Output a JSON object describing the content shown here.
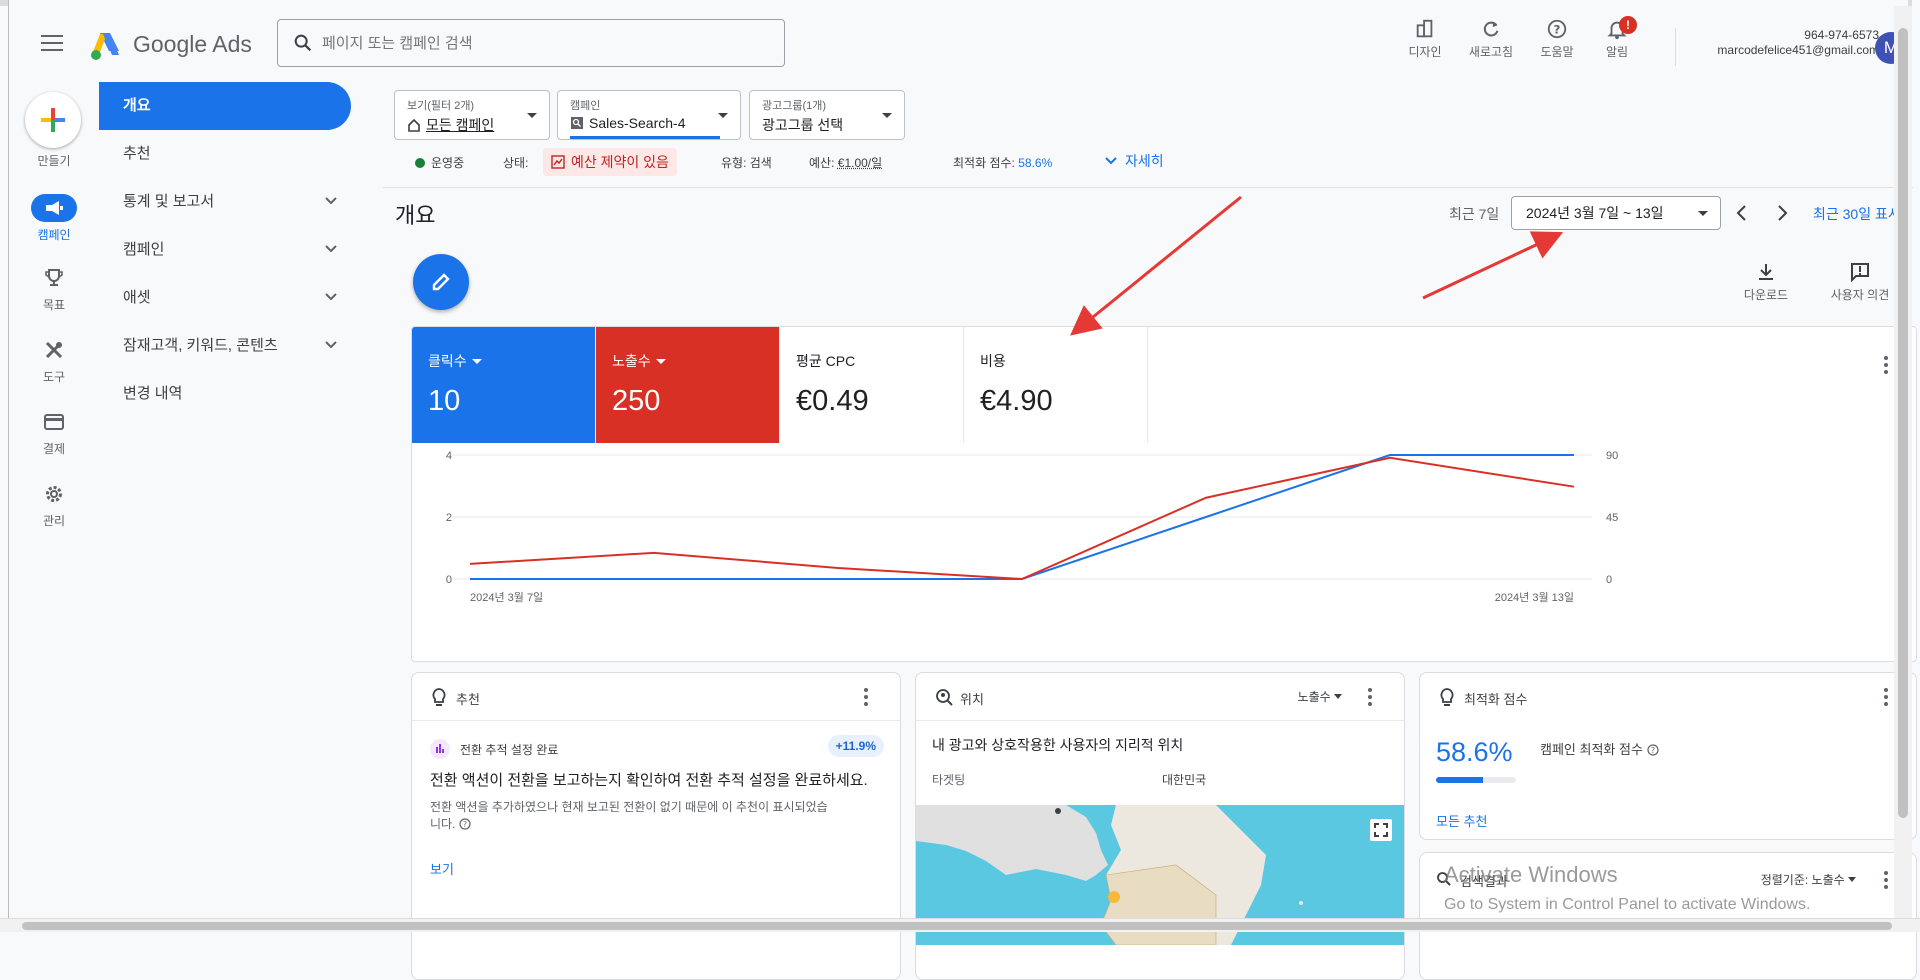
{
  "header": {
    "app_name": "Google Ads",
    "search_placeholder": "페이지 또는 캠페인 검색",
    "tools": [
      "디자인",
      "새로고침",
      "도움말",
      "알림"
    ],
    "alert_count": "!",
    "account_phone": "964-974-6573",
    "account_email": "marcodefelice451@gmail.com",
    "avatar_letter": "M"
  },
  "rail": {
    "create": "만들기",
    "campaigns": "캠페인",
    "goals": "목표",
    "tools": "도구",
    "billing": "결제",
    "admin": "관리"
  },
  "nav": {
    "items": [
      "개요",
      "추천",
      "통계 및 보고서",
      "캠페인",
      "애셋",
      "잠재고객, 키워드, 콘텐츠",
      "변경 내역"
    ]
  },
  "filters": {
    "view_label": "보기(필터 2개)",
    "view_value": "모든 캠페인",
    "campaign_label": "캠페인",
    "campaign_value": "Sales-Search-4",
    "adgroup_label": "광고그룹(1개)",
    "adgroup_value": "광고그룹 선택"
  },
  "status": {
    "running": "운영중",
    "state_label": "상태:",
    "state_value": "예산 제약이 있음",
    "type_label": "유형:",
    "type_value": "검색",
    "budget_label": "예산:",
    "budget_value": "€1.00/일",
    "score_label": "최적화 점수:",
    "score_value": "58.6%",
    "details": "자세히"
  },
  "page": {
    "title": "개요",
    "range_label": "최근 7일",
    "range_value": "2024년 3월 7일 ~ 13일",
    "range_link": "최근 30일 표시",
    "download": "다운로드",
    "feedback": "사용자 의견"
  },
  "metrics": [
    {
      "label": "클릭수",
      "value": "10"
    },
    {
      "label": "노출수",
      "value": "250"
    },
    {
      "label": "평균 CPC",
      "value": "€0.49"
    },
    {
      "label": "비용",
      "value": "€4.90"
    }
  ],
  "colors": {
    "clicks": "#1a73e8",
    "impressions": "#d93025"
  },
  "chart_data": {
    "type": "line",
    "x": [
      "2024년 3월 7일",
      "",
      "",
      "",
      "",
      "",
      "2024년 3월 13일"
    ],
    "x_tick_labels": [
      "2024년 3월 7일",
      "2024년 3월 13일"
    ],
    "y_left_ticks": [
      0,
      2,
      4
    ],
    "y_right_ticks": [
      0,
      45,
      90
    ],
    "ylim_left": [
      0,
      4
    ],
    "ylim_right": [
      0,
      90
    ],
    "series": [
      {
        "name": "클릭수",
        "axis": "left",
        "values": [
          0,
          0,
          0,
          0,
          2,
          4,
          4
        ]
      },
      {
        "name": "노출수",
        "axis": "right",
        "values": [
          11,
          19,
          8,
          0,
          59,
          88,
          67
        ]
      }
    ],
    "grid": true
  },
  "cards": {
    "rec_title": "추천",
    "rec_chip": "전환 추적 설정 완료",
    "rec_pct": "+11.9%",
    "rec_heading": "전환 액션이 전환을 보고하는지 확인하여 전환 추적 설정을 완료하세요.",
    "rec_desc": "전환 액션을 추가하였으나 현재 보고된 전환이 없기 때문에 이 추천이 표시되었습니다.",
    "rec_link": "보기",
    "loc_title": "위치",
    "loc_metric": "노출수",
    "loc_heading": "내 광고와 상호작용한 사용자의 지리적 위치",
    "loc_targeting": "타겟팅",
    "loc_country": "대한민국",
    "opt_title": "최적화 점수",
    "opt_value": "58.6%",
    "opt_fraction": 0.586,
    "opt_label": "캠페인 최적화 점수",
    "opt_link": "모든 추천",
    "search_title": "검색결과",
    "sort_label": "정렬기준: 노출수"
  },
  "watermark": {
    "line1": "Activate Windows",
    "line2": "Go to System in Control Panel to activate Windows."
  }
}
